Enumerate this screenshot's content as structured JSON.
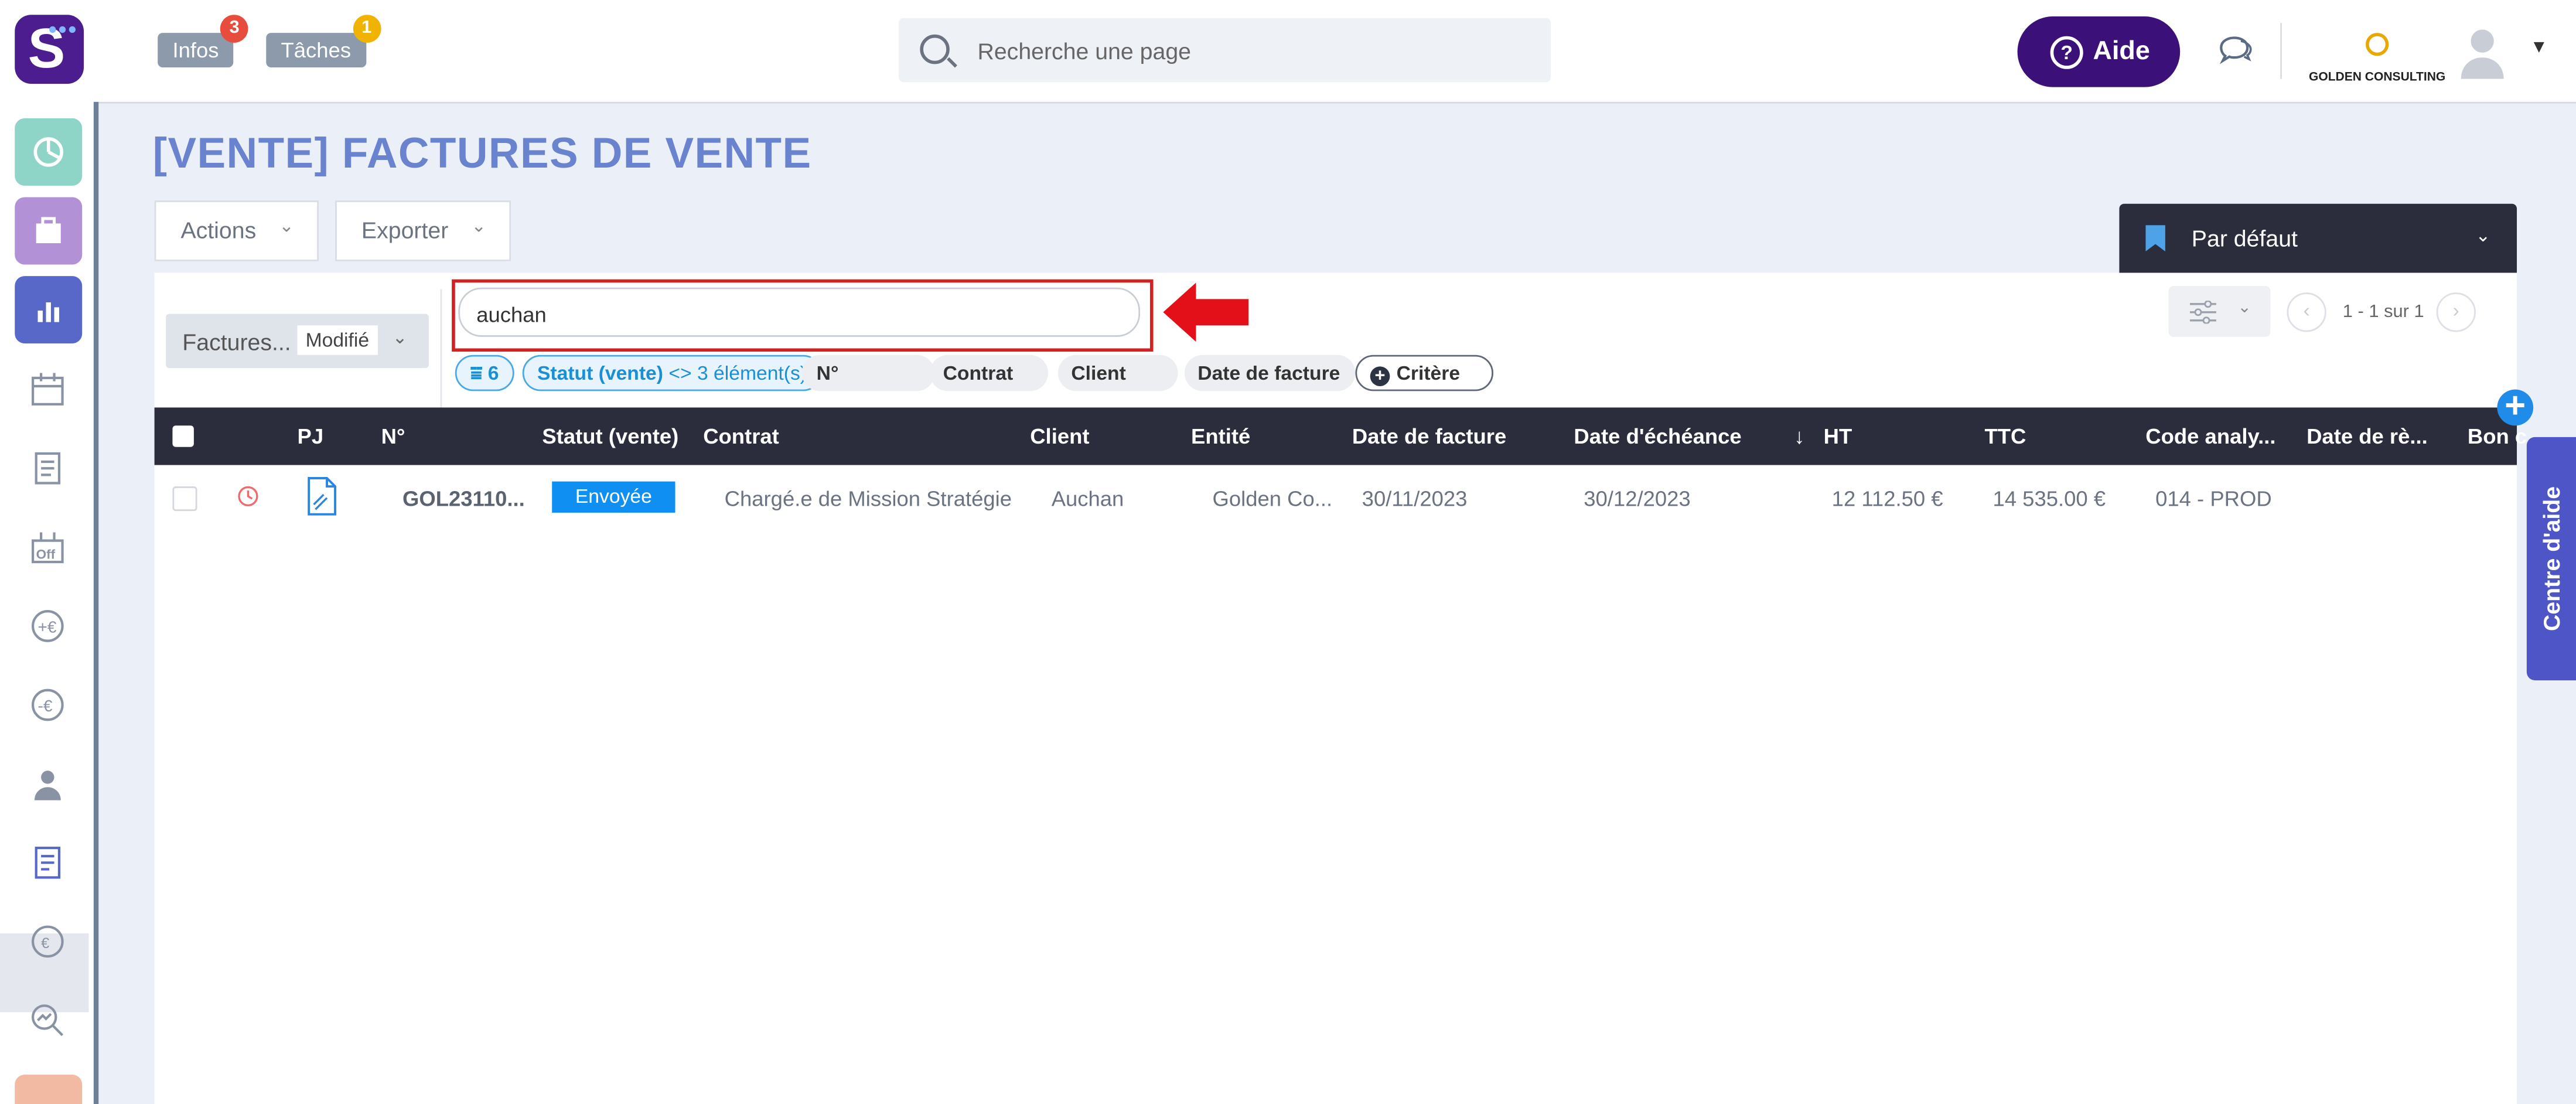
{
  "header": {
    "infos_label": "Infos",
    "infos_count": "3",
    "taches_label": "Tâches",
    "taches_count": "1",
    "search_placeholder": "Recherche une page",
    "aide_label": "Aide",
    "company_name": "GOLDEN CONSULTING",
    "colors": {
      "brand": "#4b1d8f",
      "aide": "#3c1079",
      "infos_badge": "#e74c3c",
      "taches_badge": "#f0b400"
    }
  },
  "page": {
    "title": "[VENTE] FACTURES DE VENTE",
    "actions_label": "Actions",
    "export_label": "Exporter",
    "preset_label": "Par défaut"
  },
  "filters": {
    "view_name": "Factures...",
    "view_state": "Modifié",
    "search_value": "auchan",
    "filter_count": "6",
    "chip_status_field": "Statut (vente)",
    "chip_status_value": " <> 3 élément(s)",
    "chip_numero": "N°",
    "chip_contrat": "Contrat",
    "chip_client": "Client",
    "chip_date": "Date de facture",
    "add_criterion": "Critère",
    "pagination": "1 - 1 sur 1"
  },
  "table": {
    "columns": [
      "PJ",
      "N°",
      "Statut (vente)",
      "Contrat",
      "Client",
      "Entité",
      "Date de facture",
      "Date d'échéance",
      "↓",
      "HT",
      "TTC",
      "Code analy...",
      "Date de rè...",
      "Bon c"
    ],
    "rows": [
      {
        "numero": "GOL23110...",
        "statut": "Envoyée",
        "contrat": "Chargé.e de Mission Stratégie",
        "client": "Auchan",
        "entite": "Golden Co...",
        "date_facture": "30/11/2023",
        "date_echeance": "30/12/2023",
        "ht": "12 112.50 €",
        "ttc": "14 535.00 €",
        "code_analytique": "014 - PROD"
      }
    ]
  },
  "help_tab_label": "Centre d'aide",
  "sidebar": {
    "icons": [
      "dashboard-icon",
      "briefcase-icon",
      "bar-chart-icon",
      "calendar-icon",
      "invoice-list-icon",
      "off-icon",
      "plus-euro-icon",
      "minus-euro-icon",
      "consultant-icon",
      "sales-invoice-icon",
      "euro-cycle-icon",
      "analytics-icon",
      "gift-icon"
    ]
  }
}
